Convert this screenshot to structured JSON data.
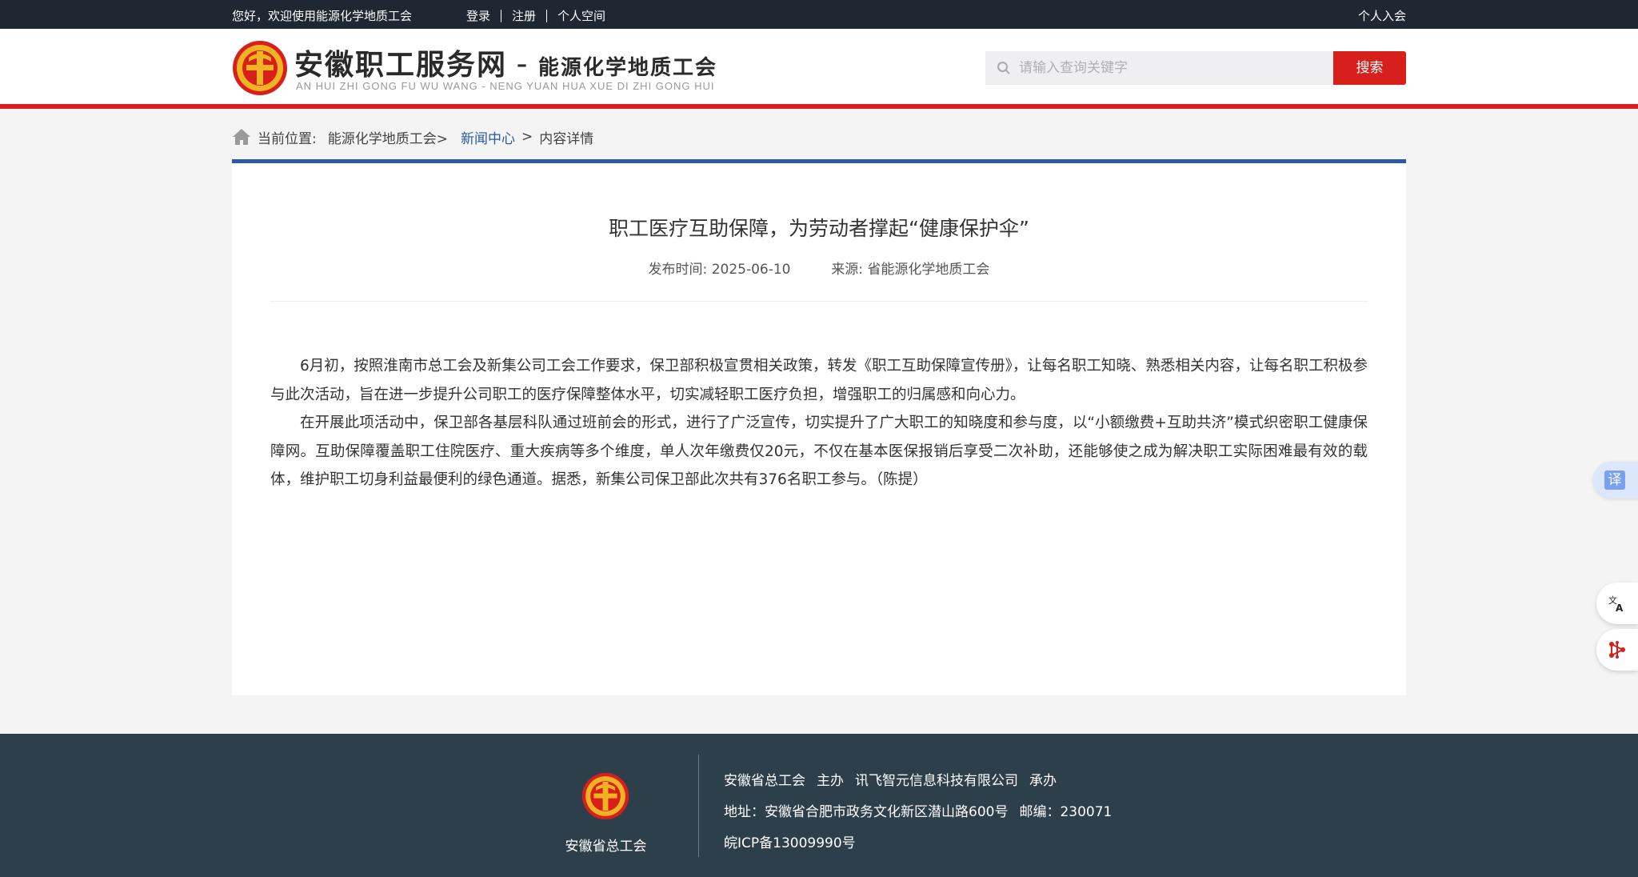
{
  "topbar": {
    "welcome": "您好，欢迎使用能源化学地质工会",
    "login": "登录",
    "register": "注册",
    "personal_space": "个人空间",
    "join": "个人入会"
  },
  "header": {
    "site_title": "安徽职工服务网",
    "dash": "–",
    "subtitle": "能源化学地质工会",
    "pinyin": "AN HUI ZHI GONG FU WU WANG - NENG YUAN HUA XUE DI ZHI GONG HUI",
    "search_placeholder": "请输入查询关键字",
    "search_button": "搜索"
  },
  "breadcrumb": {
    "label": "当前位置:",
    "level1": "能源化学地质工会>",
    "level2": "新闻中心",
    "sep": ">",
    "level3": "内容详情"
  },
  "article": {
    "title": "职工医疗互助保障，为劳动者撑起“健康保护伞”",
    "publish_label": "发布时间:",
    "publish_date": "2025-06-10",
    "source_label": "来源:",
    "source": "省能源化学地质工会",
    "paragraphs": [
      "6月初，按照淮南市总工会及新集公司工会工作要求，保卫部积极宣贯相关政策，转发《职工互助保障宣传册》，让每名职工知晓、熟悉相关内容，让每名职工积极参与此次活动，旨在进一步提升公司职工的医疗保障整体水平，切实减轻职工医疗负担，增强职工的归属感和向心力。",
      "在开展此项活动中，保卫部各基层科队通过班前会的形式，进行了广泛宣传，切实提升了广大职工的知晓度和参与度，以“小额缴费+互助共济”模式织密职工健康保障网。互助保障覆盖职工住院医疗、重大疾病等多个维度，单人次年缴费仅20元，不仅在基本医保报销后享受二次补助，还能够使之成为解决职工实际困难最有效的载体，维护职工切身利益最便利的绿色通道。据悉，新集公司保卫部此次共有376名职工参与。（陈提）"
    ]
  },
  "float": {
    "translate_char": "译"
  },
  "footer": {
    "org_name": "安徽省总工会",
    "host": "安徽省总工会",
    "host_role": "主办",
    "organizer": "讯飞智元信息科技有限公司",
    "organizer_role": "承办",
    "address": "地址：安徽省合肥市政务文化新区潜山路600号",
    "postcode": "邮编：230071",
    "icp": "皖ICP备13009990号"
  },
  "colors": {
    "topbar_bg": "#1f2733",
    "brand_red": "#d7201c",
    "accent_blue": "#2c5aa0",
    "footer_bg": "#2e3f4c"
  },
  "icons": [
    "union-emblem-icon",
    "search-icon",
    "home-icon",
    "translate-icon",
    "language-icon",
    "network-icon"
  ]
}
